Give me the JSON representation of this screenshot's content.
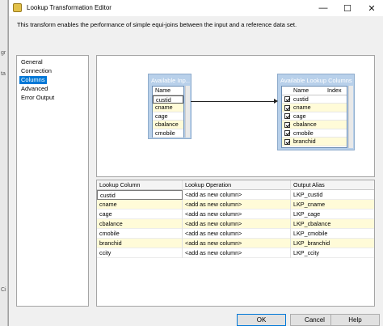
{
  "window": {
    "title": "Lookup Transformation Editor",
    "description": "This transform enables the performance of simple equi-joins between the input and a reference data set."
  },
  "nav": {
    "items": [
      {
        "label": "General",
        "selected": false
      },
      {
        "label": "Connection",
        "selected": false
      },
      {
        "label": "Columns",
        "selected": true
      },
      {
        "label": "Advanced",
        "selected": false
      },
      {
        "label": "Error Output",
        "selected": false
      }
    ]
  },
  "input_box": {
    "title": "Available Inp...",
    "header": "Name",
    "columns": [
      "custid",
      "cname",
      "cage",
      "cbalance",
      "cmobile",
      "branchid"
    ]
  },
  "lookup_box": {
    "title": "Available Lookup Columns",
    "header_name": "Name",
    "header_index": "Index",
    "columns": [
      "custid",
      "cname",
      "cage",
      "cbalance",
      "cmobile",
      "branchid"
    ]
  },
  "grid": {
    "headers": [
      "Lookup Column",
      "Lookup Operation",
      "Output Alias"
    ],
    "rows": [
      {
        "lookup_column": "custid",
        "operation": "<add as new column>",
        "alias": "LKP_custid"
      },
      {
        "lookup_column": "cname",
        "operation": "<add as new column>",
        "alias": "LKP_cname"
      },
      {
        "lookup_column": "cage",
        "operation": "<add as new column>",
        "alias": "LKP_cage"
      },
      {
        "lookup_column": "cbalance",
        "operation": "<add as new column>",
        "alias": "LKP_cbalance"
      },
      {
        "lookup_column": "cmobile",
        "operation": "<add as new column>",
        "alias": "LKP_cmobile"
      },
      {
        "lookup_column": "branchid",
        "operation": "<add as new column>",
        "alias": "LKP_branchid"
      },
      {
        "lookup_column": "ccity",
        "operation": "<add as new column>",
        "alias": "LKP_ccity"
      }
    ]
  },
  "buttons": {
    "ok": "OK",
    "cancel": "Cancel",
    "help": "Help"
  },
  "window_controls": {
    "minimize": "—",
    "maximize": "☐",
    "close": "✕"
  },
  "colors": {
    "selection": "#0078d7",
    "box_fill": "#b8d0ea",
    "row_highlight": "#fffbd8"
  }
}
